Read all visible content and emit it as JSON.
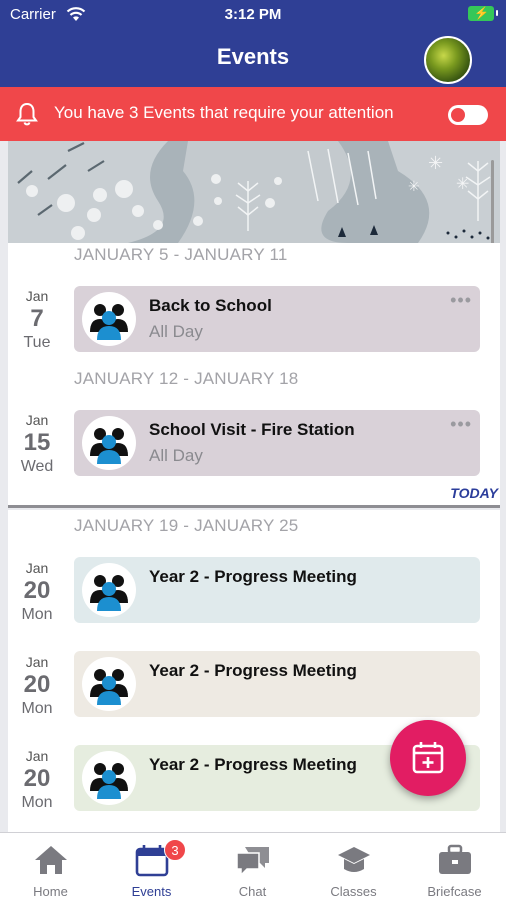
{
  "status_bar": {
    "carrier": "Carrier",
    "time": "3:12 PM"
  },
  "header": {
    "title": "Events"
  },
  "alert": {
    "message": "You have 3 Events that require your attention"
  },
  "weeks": [
    {
      "label": "JANUARY 5 - JANUARY 11"
    },
    {
      "label": "JANUARY 12 - JANUARY 18"
    },
    {
      "label": "JANUARY 19 - JANUARY 25"
    }
  ],
  "events": [
    {
      "month": "Jan",
      "day": "7",
      "weekday": "Tue",
      "title": "Back to School",
      "subtitle": "All Day",
      "color": "#d9d1d8"
    },
    {
      "month": "Jan",
      "day": "15",
      "weekday": "Wed",
      "title": "School Visit - Fire Station",
      "subtitle": "All Day",
      "color": "#d9d1d8"
    },
    {
      "month": "Jan",
      "day": "20",
      "weekday": "Mon",
      "title": "Year 2 - Progress Meeting",
      "color": "#e0eaec"
    },
    {
      "month": "Jan",
      "day": "20",
      "weekday": "Mon",
      "title": "Year 2 - Progress Meeting",
      "color": "#eeeae3"
    },
    {
      "month": "Jan",
      "day": "20",
      "weekday": "Mon",
      "title": "Year 2 - Progress Meeting",
      "color": "#e6eddf"
    }
  ],
  "more_label": "•••",
  "today_label": "TODAY",
  "tabs": [
    {
      "label": "Home",
      "icon": "home-icon"
    },
    {
      "label": "Events",
      "icon": "calendar-icon",
      "badge": "3",
      "active": true
    },
    {
      "label": "Chat",
      "icon": "chat-icon"
    },
    {
      "label": "Classes",
      "icon": "graduation-cap-icon"
    },
    {
      "label": "Briefcase",
      "icon": "briefcase-icon"
    }
  ],
  "colors": {
    "header": "#2f3f95",
    "alert": "#f0474a",
    "fab": "#e21d63",
    "accent": "#2b3d9b"
  }
}
